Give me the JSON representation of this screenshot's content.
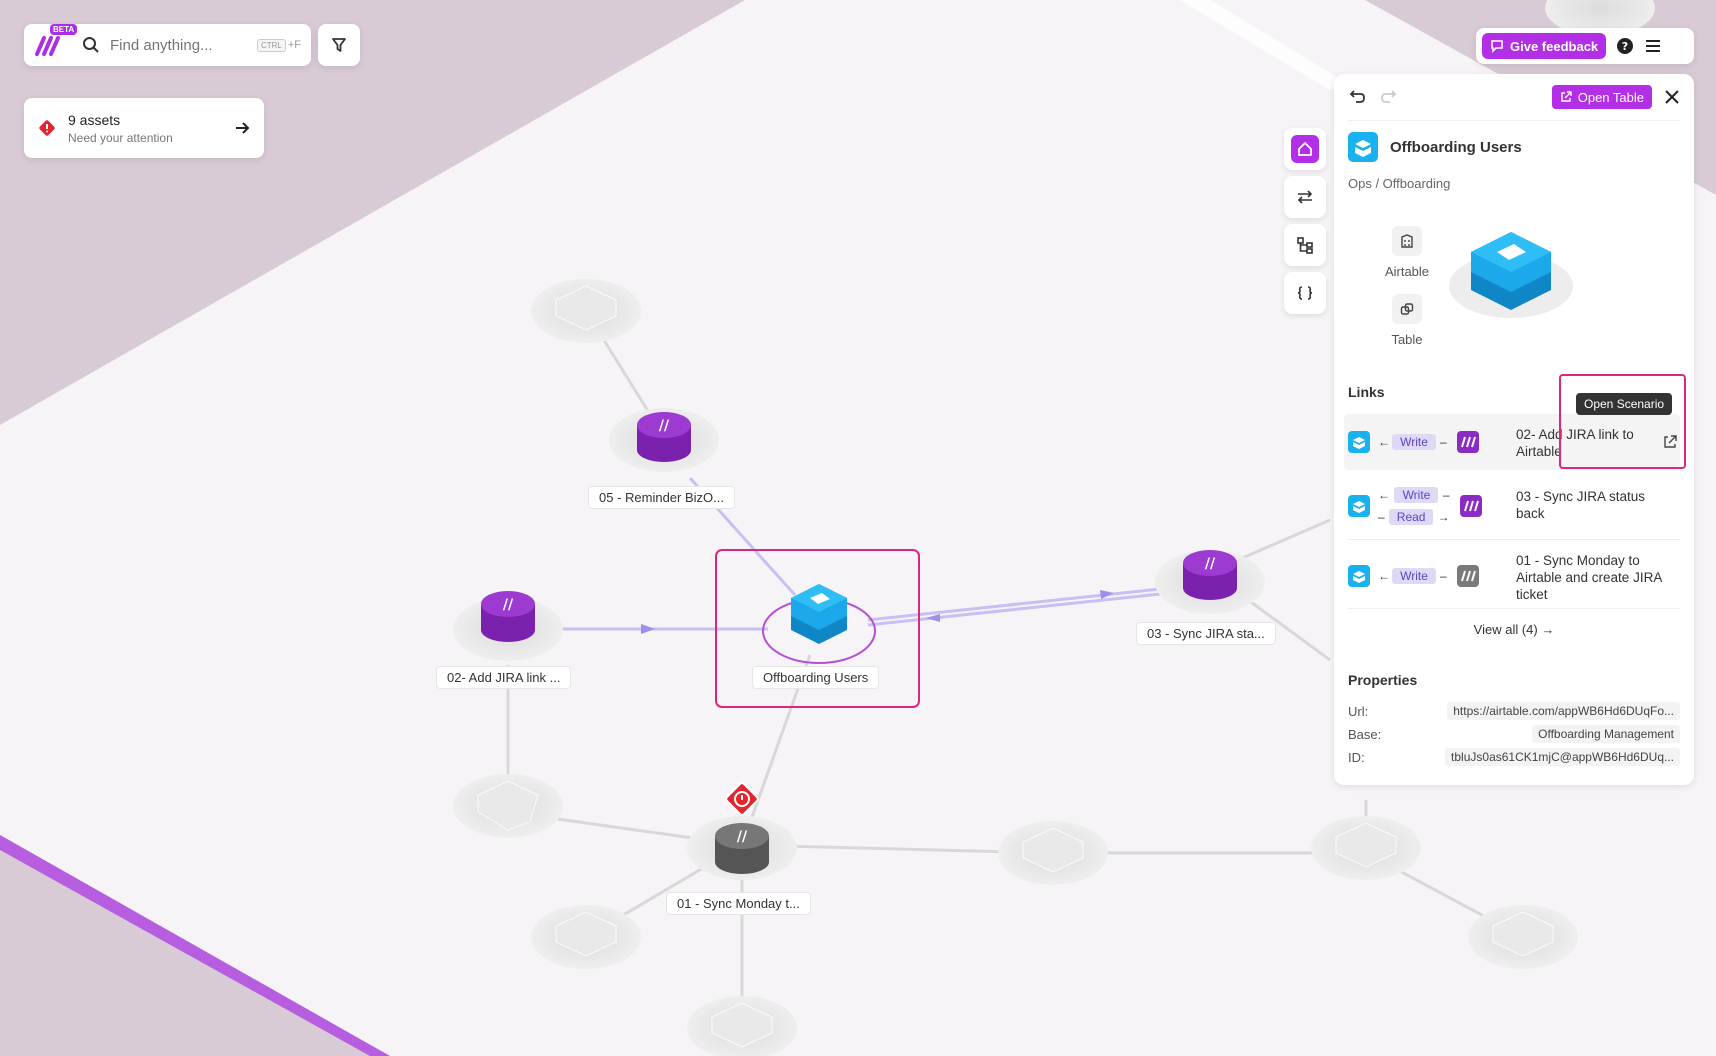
{
  "topbar": {
    "beta_label": "BETA",
    "search_placeholder": "Find anything...",
    "shortcut_key": "CTRL",
    "shortcut_suffix": "+F"
  },
  "alerts": {
    "title": "9 assets",
    "subtitle": "Need your attention"
  },
  "header_right": {
    "feedback_label": "Give feedback"
  },
  "graph": {
    "nodes": [
      {
        "label": "05 - Reminder BizO..."
      },
      {
        "label": "02- Add JIRA link ..."
      },
      {
        "label": "Offboarding Users"
      },
      {
        "label": "03 - Sync JIRA sta..."
      },
      {
        "label": "01 - Sync Monday t..."
      }
    ]
  },
  "panel": {
    "open_table_label": "Open Table",
    "title": "Offboarding Users",
    "path": "Ops / Offboarding",
    "meta": [
      {
        "label": "Airtable",
        "icon": "building-icon"
      },
      {
        "label": "Table",
        "icon": "link-icon"
      }
    ],
    "links_heading": "Links",
    "tooltip": "Open Scenario",
    "links": [
      {
        "modes": [
          "Write"
        ],
        "name": "02- Add JIRA link to Airtable",
        "active": true
      },
      {
        "modes": [
          "Write",
          "Read"
        ],
        "name": "03 - Sync JIRA status back",
        "active": true
      },
      {
        "modes": [
          "Write"
        ],
        "name": "01 - Sync Monday to Airtable and create JIRA ticket",
        "active": false
      }
    ],
    "view_all": "View all (4) →",
    "properties_heading": "Properties",
    "properties": [
      {
        "label": "Url:",
        "value": "https://airtable.com/appWB6Hd6DUqFo..."
      },
      {
        "label": "Base:",
        "value": "Offboarding Management"
      },
      {
        "label": "ID:",
        "value": "tbluJs0as61CK1mjC@appWB6Hd6DUq..."
      }
    ]
  },
  "colors": {
    "accent": "#b22fe6",
    "airtable_blue": "#19b2ee",
    "make_purple": "#8a2bc4",
    "highlight": "#e0257d",
    "error_red": "#e2262d"
  }
}
